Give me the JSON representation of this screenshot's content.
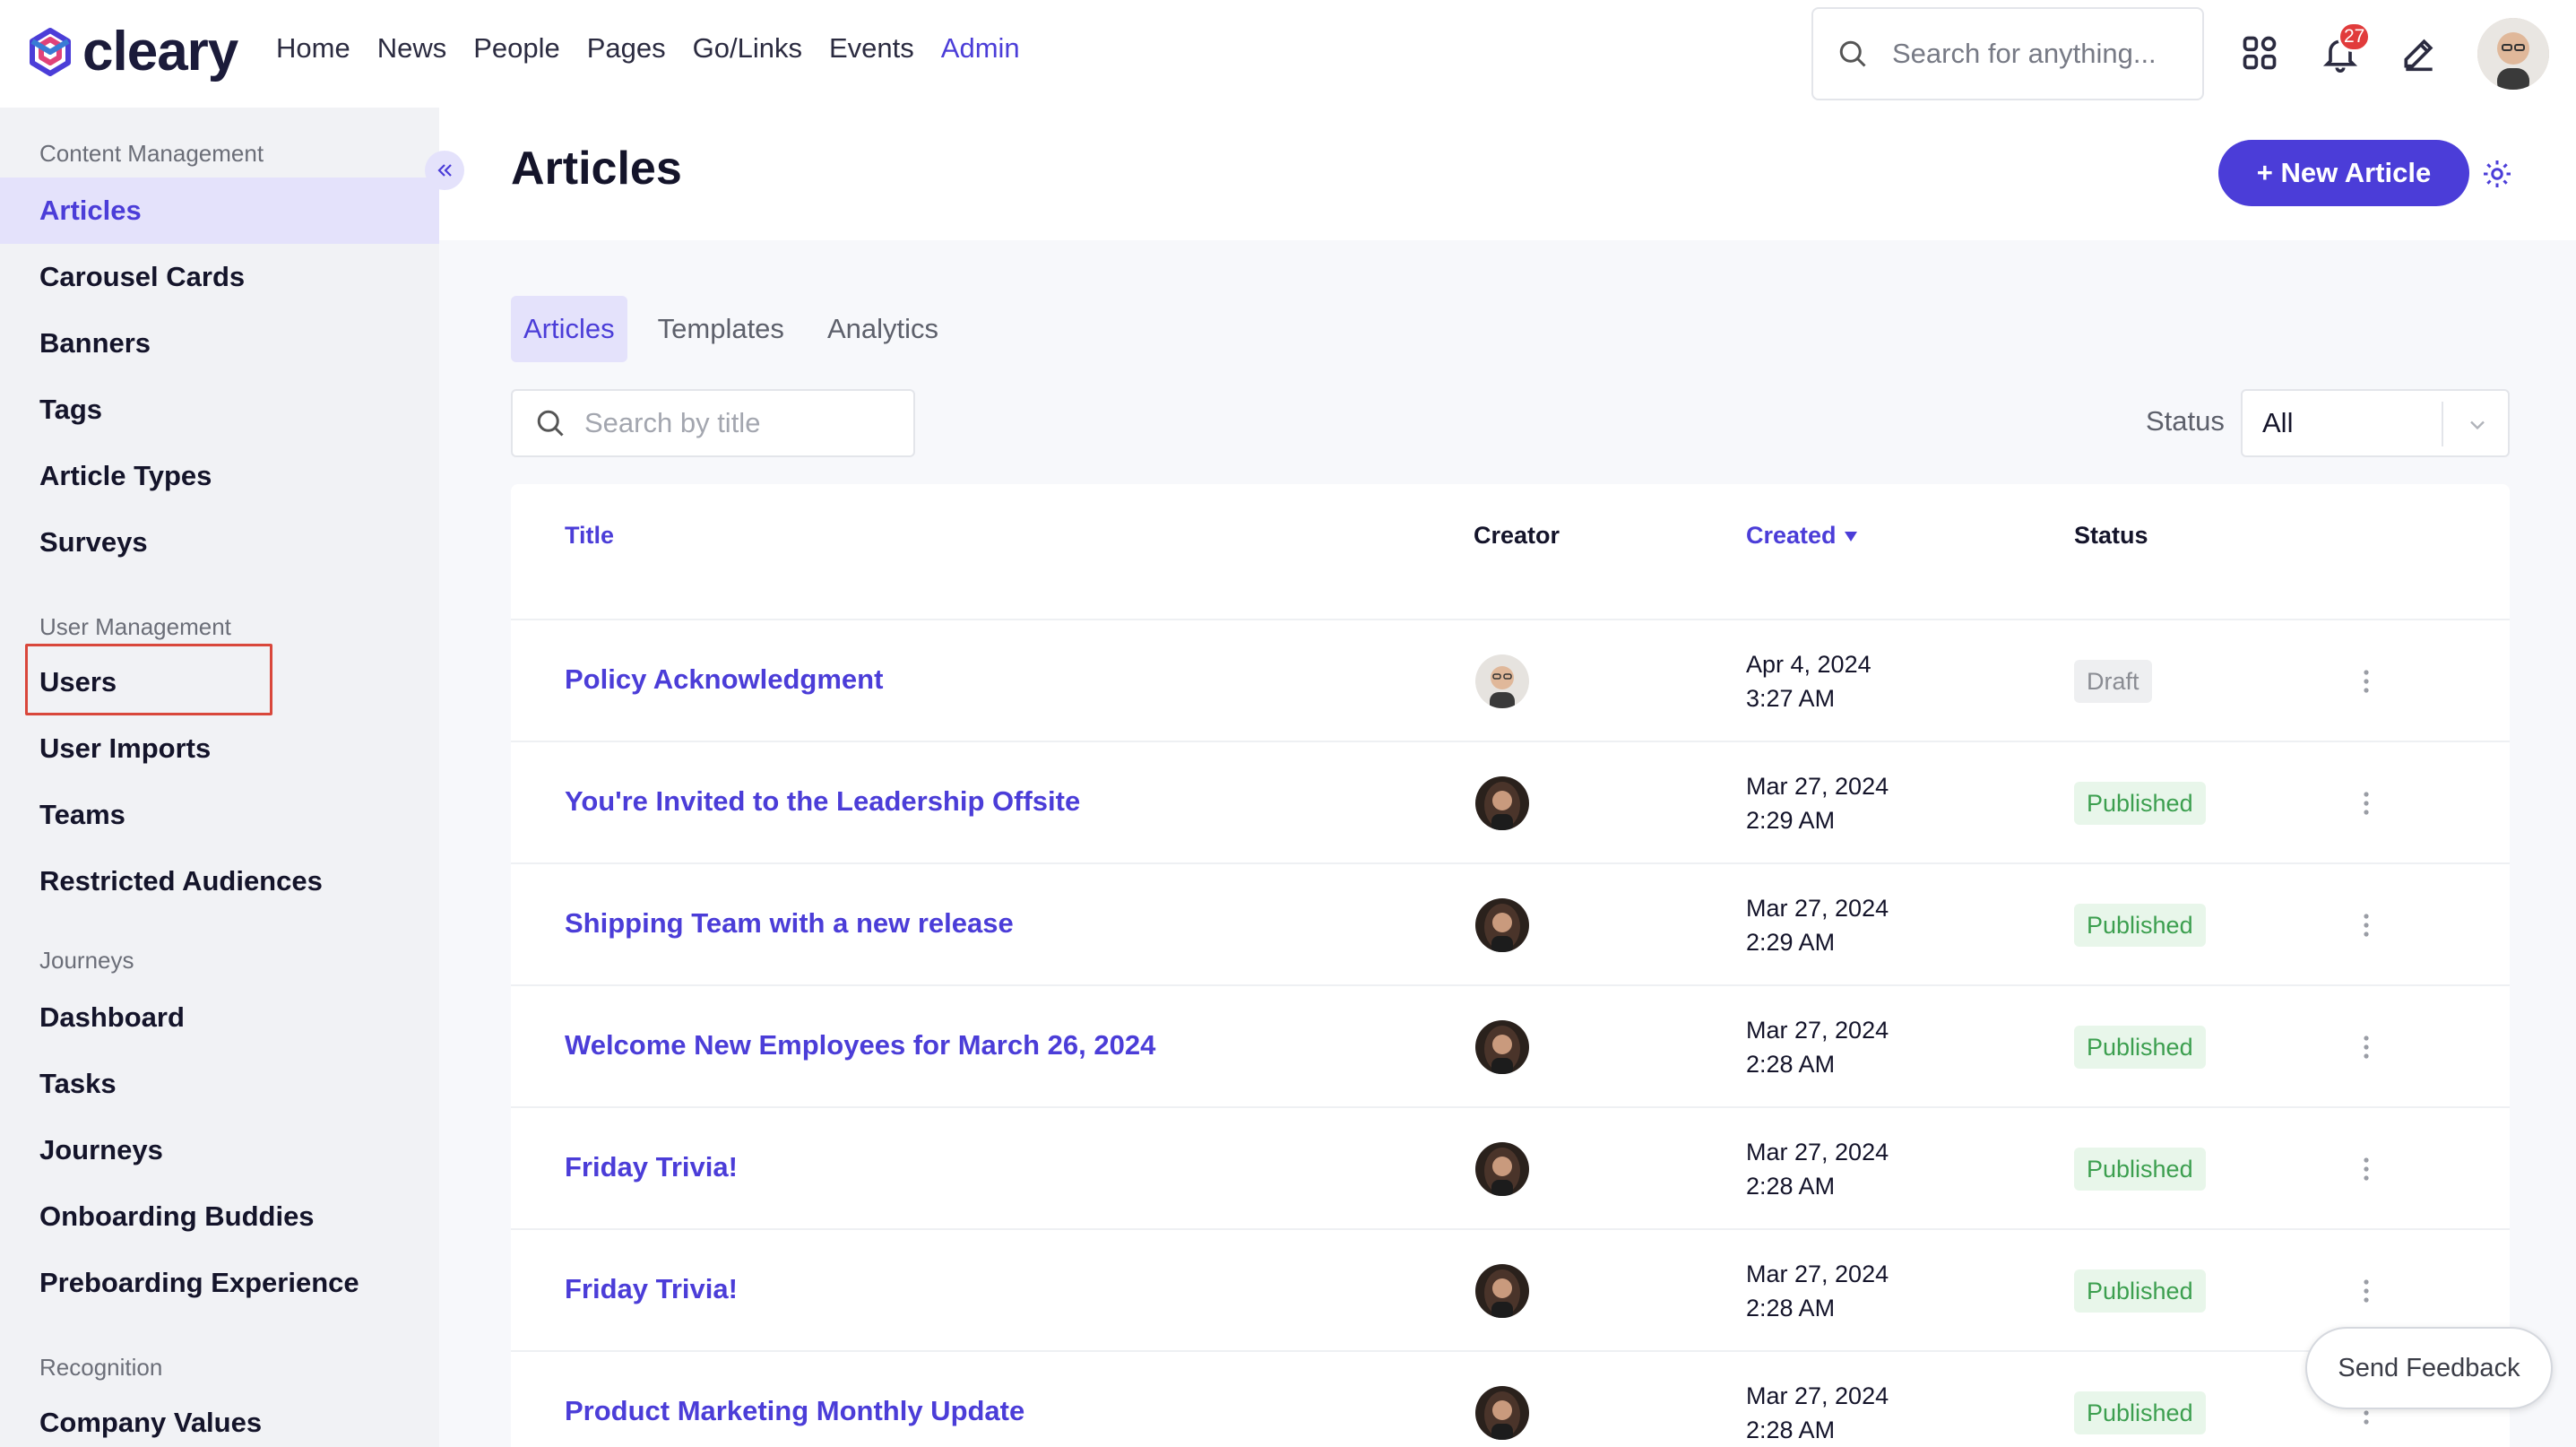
{
  "brand": {
    "name": "cleary",
    "accent": "#4b3dd8"
  },
  "nav": {
    "items": [
      {
        "label": "Home"
      },
      {
        "label": "News"
      },
      {
        "label": "People"
      },
      {
        "label": "Pages"
      },
      {
        "label": "Go/Links"
      },
      {
        "label": "Events"
      },
      {
        "label": "Admin",
        "active": true
      }
    ]
  },
  "search": {
    "placeholder": "Search for anything..."
  },
  "notifications": {
    "count": "27"
  },
  "sidebar": {
    "sections": [
      {
        "label": "Content Management",
        "items": [
          "Articles",
          "Carousel Cards",
          "Banners",
          "Tags",
          "Article Types",
          "Surveys"
        ]
      },
      {
        "label": "User Management",
        "items": [
          "Users",
          "User Imports",
          "Teams",
          "Restricted Audiences"
        ]
      },
      {
        "label": "Journeys",
        "items": [
          "Dashboard",
          "Tasks",
          "Journeys",
          "Onboarding Buddies",
          "Preboarding Experience"
        ]
      },
      {
        "label": "Recognition",
        "items": [
          "Company Values"
        ]
      }
    ],
    "active_item": "Articles",
    "highlighted_item": "Users"
  },
  "page": {
    "title": "Articles",
    "new_button": "+ New Article",
    "tabs": [
      {
        "label": "Articles",
        "active": true
      },
      {
        "label": "Templates"
      },
      {
        "label": "Analytics"
      }
    ],
    "title_search_placeholder": "Search by title",
    "status_filter": {
      "label": "Status",
      "value": "All"
    }
  },
  "table": {
    "headers": {
      "title": "Title",
      "creator": "Creator",
      "created": "Created",
      "status": "Status"
    },
    "rows": [
      {
        "title": "Policy Acknowledgment",
        "date": "Apr 4, 2024",
        "time": "3:27 AM",
        "status": "Draft"
      },
      {
        "title": "You're Invited to the Leadership Offsite",
        "date": "Mar 27, 2024",
        "time": "2:29 AM",
        "status": "Published"
      },
      {
        "title": "Shipping Team with a new release",
        "date": "Mar 27, 2024",
        "time": "2:29 AM",
        "status": "Published"
      },
      {
        "title": "Welcome New Employees for March 26, 2024",
        "date": "Mar 27, 2024",
        "time": "2:28 AM",
        "status": "Published"
      },
      {
        "title": "Friday Trivia!",
        "date": "Mar 27, 2024",
        "time": "2:28 AM",
        "status": "Published"
      },
      {
        "title": "Friday Trivia!",
        "date": "Mar 27, 2024",
        "time": "2:28 AM",
        "status": "Published"
      },
      {
        "title": "Product Marketing Monthly Update",
        "date": "Mar 27, 2024",
        "time": "2:28 AM",
        "status": "Published"
      }
    ]
  },
  "feedback_button": "Send Feedback",
  "colors": {
    "accent": "#4b3dd8",
    "published": "#3c9f4f",
    "draft": "#8a8c93",
    "highlight": "#d9473b",
    "badge": "#e13b3b"
  }
}
